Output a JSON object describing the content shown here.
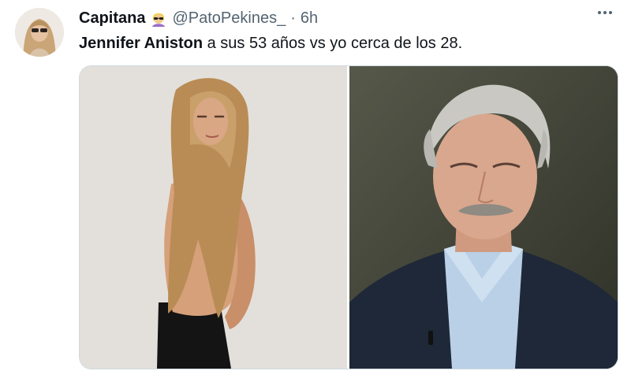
{
  "tweet": {
    "display_name": "Capitana",
    "handle": "@PatoPekines_",
    "separator": "·",
    "time": "6h",
    "text": {
      "highlight": "Jennifer Aniston",
      "rest": " a sus 53 años vs yo cerca de los 28."
    }
  },
  "icons": {
    "more": "more-options-icon",
    "emoji": "person-with-sunglasses-emoji"
  },
  "colors": {
    "text_primary": "#0f1419",
    "text_secondary": "#536471",
    "border": "#cfd9de"
  }
}
